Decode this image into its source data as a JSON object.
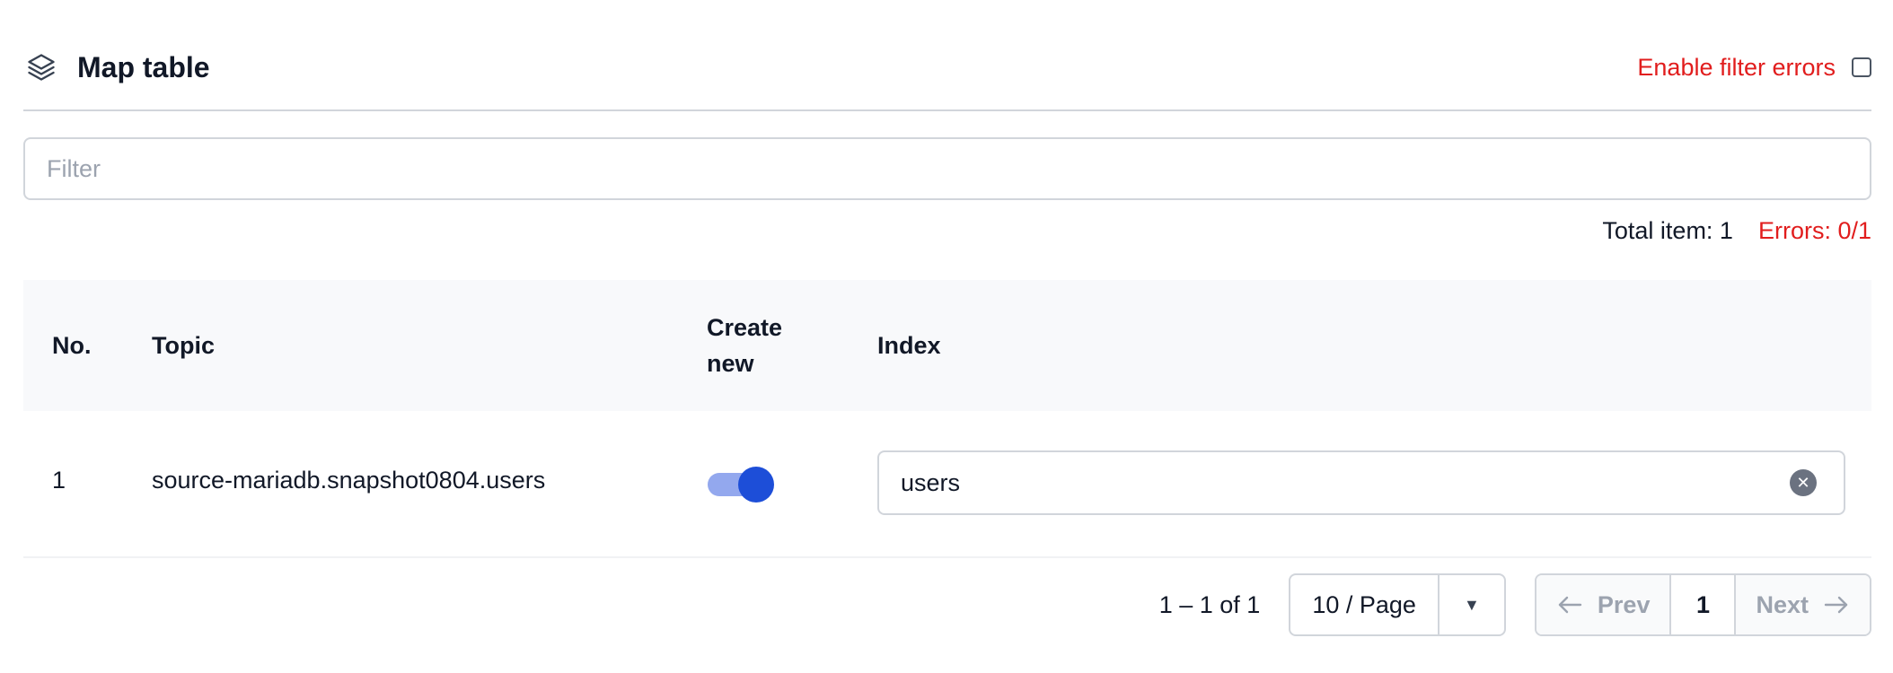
{
  "header": {
    "title": "Map table",
    "title_icon": "layers-icon",
    "filter_errors_label": "Enable filter errors",
    "filter_errors_checked": false
  },
  "filter": {
    "placeholder": "Filter",
    "value": ""
  },
  "totals": {
    "total_item": "Total item: 1",
    "errors": "Errors: 0/1"
  },
  "colors": {
    "error": "#e11d1d",
    "toggle_on": "#1d4ed8",
    "toggle_track": "#93a8ee"
  },
  "table": {
    "columns": [
      "No.",
      "Topic",
      "Create new",
      "Index"
    ],
    "rows": [
      {
        "no": "1",
        "topic": "source-mariadb.snapshot0804.users",
        "create_new": true,
        "index": "users"
      }
    ]
  },
  "pagination": {
    "range": "1 – 1 of 1",
    "page_size": "10 / Page",
    "prev_label": "Prev",
    "next_label": "Next",
    "current_page": "1"
  }
}
